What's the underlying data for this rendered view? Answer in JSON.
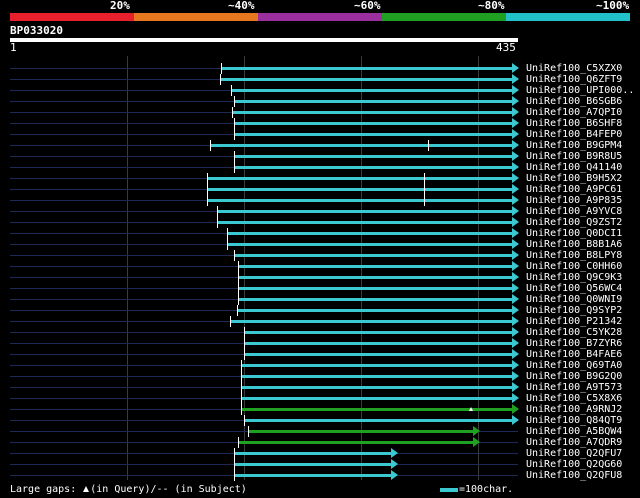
{
  "identity_ticks": [
    "20%",
    "~40%",
    "~60%",
    "~80%",
    "~100%"
  ],
  "identity_colors": [
    "#e8202e",
    "#e87820",
    "#9b2f9e",
    "#20a020",
    "#22c0c8"
  ],
  "query": {
    "id": "BP033020",
    "start": "1",
    "end": "435",
    "length": 435
  },
  "hits": [
    {
      "id": "UniRef100_C5XZX0",
      "start": 181,
      "end": 435,
      "color": "#3cc8d0",
      "ticks": [
        181
      ]
    },
    {
      "id": "UniRef100_Q6ZFT9",
      "start": 180,
      "end": 435,
      "color": "#3cc8d0",
      "ticks": [
        180
      ]
    },
    {
      "id": "UniRef100_UPI000..",
      "start": 190,
      "end": 435,
      "color": "#3cc8d0",
      "ticks": [
        190
      ]
    },
    {
      "id": "UniRef100_B6SGB6",
      "start": 192,
      "end": 435,
      "color": "#3cc8d0",
      "ticks": [
        192
      ]
    },
    {
      "id": "UniRef100_A7QPI0",
      "start": 191,
      "end": 435,
      "color": "#3cc8d0",
      "ticks": [
        191
      ]
    },
    {
      "id": "UniRef100_B6SHF8",
      "start": 192,
      "end": 435,
      "color": "#3cc8d0",
      "ticks": [
        192
      ]
    },
    {
      "id": "UniRef100_B4FEP0",
      "start": 192,
      "end": 435,
      "color": "#3cc8d0",
      "ticks": [
        192
      ]
    },
    {
      "id": "UniRef100_B9GPM4",
      "start": 172,
      "end": 435,
      "color": "#3cc8d0",
      "ticks": [
        172,
        358
      ]
    },
    {
      "id": "UniRef100_B9R8U5",
      "start": 192,
      "end": 435,
      "color": "#3cc8d0",
      "ticks": [
        192
      ]
    },
    {
      "id": "UniRef100_Q41140",
      "start": 192,
      "end": 435,
      "color": "#3cc8d0",
      "ticks": [
        192
      ]
    },
    {
      "id": "UniRef100_B9H5X2",
      "start": 169,
      "end": 435,
      "color": "#3cc8d0",
      "ticks": [
        169,
        355
      ]
    },
    {
      "id": "UniRef100_A9PC61",
      "start": 169,
      "end": 435,
      "color": "#3cc8d0",
      "ticks": [
        169,
        355
      ]
    },
    {
      "id": "UniRef100_A9P835",
      "start": 169,
      "end": 435,
      "color": "#3cc8d0",
      "ticks": [
        169,
        355
      ]
    },
    {
      "id": "UniRef100_A9YVC8",
      "start": 178,
      "end": 435,
      "color": "#3cc8d0",
      "ticks": [
        178
      ]
    },
    {
      "id": "UniRef100_Q9ZST2",
      "start": 178,
      "end": 435,
      "color": "#3cc8d0",
      "ticks": [
        178
      ]
    },
    {
      "id": "UniRef100_Q0DCI1",
      "start": 186,
      "end": 435,
      "color": "#3cc8d0",
      "ticks": [
        186
      ]
    },
    {
      "id": "UniRef100_B8B1A6",
      "start": 186,
      "end": 435,
      "color": "#3cc8d0",
      "ticks": [
        186
      ]
    },
    {
      "id": "UniRef100_B8LPY8",
      "start": 192,
      "end": 435,
      "color": "#3cc8d0",
      "ticks": [
        192
      ]
    },
    {
      "id": "UniRef100_C0HH60",
      "start": 196,
      "end": 435,
      "color": "#3cc8d0",
      "ticks": [
        196
      ]
    },
    {
      "id": "UniRef100_Q9C9K3",
      "start": 196,
      "end": 435,
      "color": "#3cc8d0",
      "ticks": [
        196
      ]
    },
    {
      "id": "UniRef100_Q56WC4",
      "start": 196,
      "end": 435,
      "color": "#3cc8d0",
      "ticks": [
        196
      ]
    },
    {
      "id": "UniRef100_Q0WNI9",
      "start": 196,
      "end": 435,
      "color": "#3cc8d0",
      "ticks": [
        196
      ]
    },
    {
      "id": "UniRef100_Q9SYP2",
      "start": 195,
      "end": 435,
      "color": "#3cc8d0",
      "ticks": [
        195
      ]
    },
    {
      "id": "UniRef100_P21342",
      "start": 189,
      "end": 435,
      "color": "#3cc8d0",
      "ticks": [
        189
      ]
    },
    {
      "id": "UniRef100_C5YK28",
      "start": 201,
      "end": 435,
      "color": "#3cc8d0",
      "ticks": [
        201
      ]
    },
    {
      "id": "UniRef100_B7ZYR6",
      "start": 201,
      "end": 435,
      "color": "#3cc8d0",
      "ticks": [
        201
      ]
    },
    {
      "id": "UniRef100_B4FAE6",
      "start": 201,
      "end": 435,
      "color": "#3cc8d0",
      "ticks": [
        201
      ]
    },
    {
      "id": "UniRef100_Q69TA0",
      "start": 198,
      "end": 435,
      "color": "#3cc8d0",
      "ticks": [
        198
      ]
    },
    {
      "id": "UniRef100_B9G2Q0",
      "start": 198,
      "end": 435,
      "color": "#3cc8d0",
      "ticks": [
        198
      ]
    },
    {
      "id": "UniRef100_A9T573",
      "start": 198,
      "end": 435,
      "color": "#3cc8d0",
      "ticks": [
        198
      ]
    },
    {
      "id": "UniRef100_C5X8X6",
      "start": 198,
      "end": 435,
      "color": "#3cc8d0",
      "ticks": [
        198
      ]
    },
    {
      "id": "UniRef100_A9RNJ2",
      "start": 198,
      "end": 435,
      "color": "#20a020",
      "ticks": [
        198
      ],
      "gap_at": 395
    },
    {
      "id": "UniRef100_Q84QT9",
      "start": 201,
      "end": 435,
      "color": "#3cc8d0",
      "ticks": [
        201
      ]
    },
    {
      "id": "UniRef100_A5BQW4",
      "start": 204,
      "end": 402,
      "color": "#20a020",
      "ticks": [
        204
      ]
    },
    {
      "id": "UniRef100_A7QDR9",
      "start": 196,
      "end": 402,
      "color": "#20a020",
      "ticks": [
        196
      ]
    },
    {
      "id": "UniRef100_Q2QFU7",
      "start": 192,
      "end": 332,
      "color": "#3cc8d0",
      "ticks": [
        192
      ]
    },
    {
      "id": "UniRef100_Q2QG60",
      "start": 192,
      "end": 332,
      "color": "#3cc8d0",
      "ticks": [
        192
      ]
    },
    {
      "id": "UniRef100_Q2QFU8",
      "start": 192,
      "end": 332,
      "color": "#3cc8d0",
      "ticks": [
        192
      ]
    }
  ],
  "legend": {
    "gaps_prefix": "Large gaps:",
    "gaps_query": "(in Query)/",
    "gaps_subject": "-- (in Subject)",
    "scale_text": "=100char."
  }
}
